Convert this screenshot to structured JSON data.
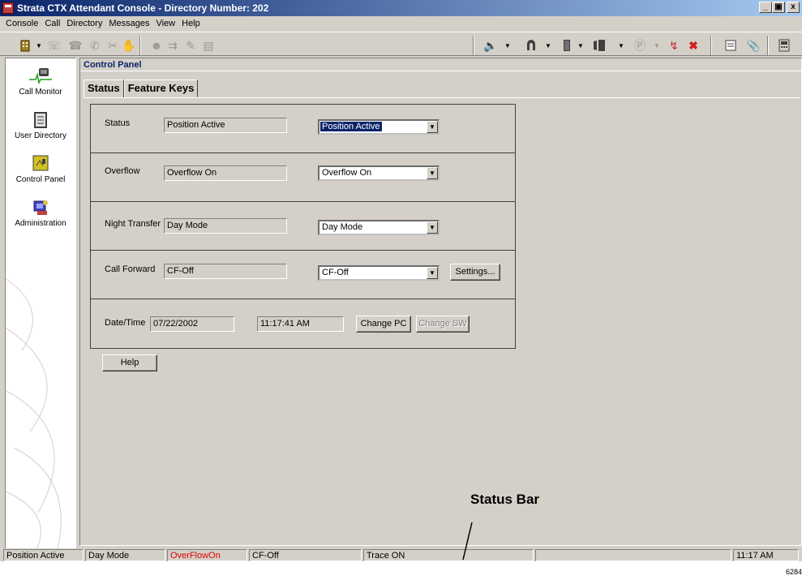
{
  "window": {
    "title": "Strata CTX Attendant Console - Directory Number: 202",
    "controls": [
      "_",
      "\u0018",
      "x"
    ]
  },
  "menu": [
    "Console",
    "Call",
    "Directory",
    "Messages",
    "View",
    "Help"
  ],
  "sidebar": {
    "items": [
      {
        "label": "Call Monitor",
        "icon": "call-monitor-icon"
      },
      {
        "label": "User Directory",
        "icon": "user-directory-icon"
      },
      {
        "label": "Control Panel",
        "icon": "control-panel-icon"
      },
      {
        "label": "Administration",
        "icon": "administration-icon"
      }
    ]
  },
  "main": {
    "header": "Control Panel",
    "tabs": [
      "Status",
      "Feature Keys"
    ],
    "rows": {
      "status": {
        "label": "Status",
        "value": "Position Active",
        "selected": "Position Active"
      },
      "overflow": {
        "label": "Overflow",
        "value": "Overflow On",
        "selected": "Overflow On"
      },
      "night": {
        "label": "Night Transfer",
        "value": "Day Mode",
        "selected": "Day Mode"
      },
      "forward": {
        "label": "Call Forward",
        "value": "CF-Off",
        "selected": "CF-Off",
        "button": "Settings..."
      },
      "datetime": {
        "label": "Date/Time",
        "date": "07/22/2002",
        "time": "11:17:41 AM",
        "change_pc": "Change PC",
        "change_sw": "Change SW"
      }
    },
    "help_button": "Help"
  },
  "statusbar": {
    "cells": [
      "Position Active",
      "Day Mode",
      "OverFlowOn",
      "CF-Off",
      "Trace ON",
      "",
      "",
      "11:17 AM"
    ],
    "overflow_color": "#e00000"
  },
  "callout": "Status Bar",
  "figure_id": "6284"
}
